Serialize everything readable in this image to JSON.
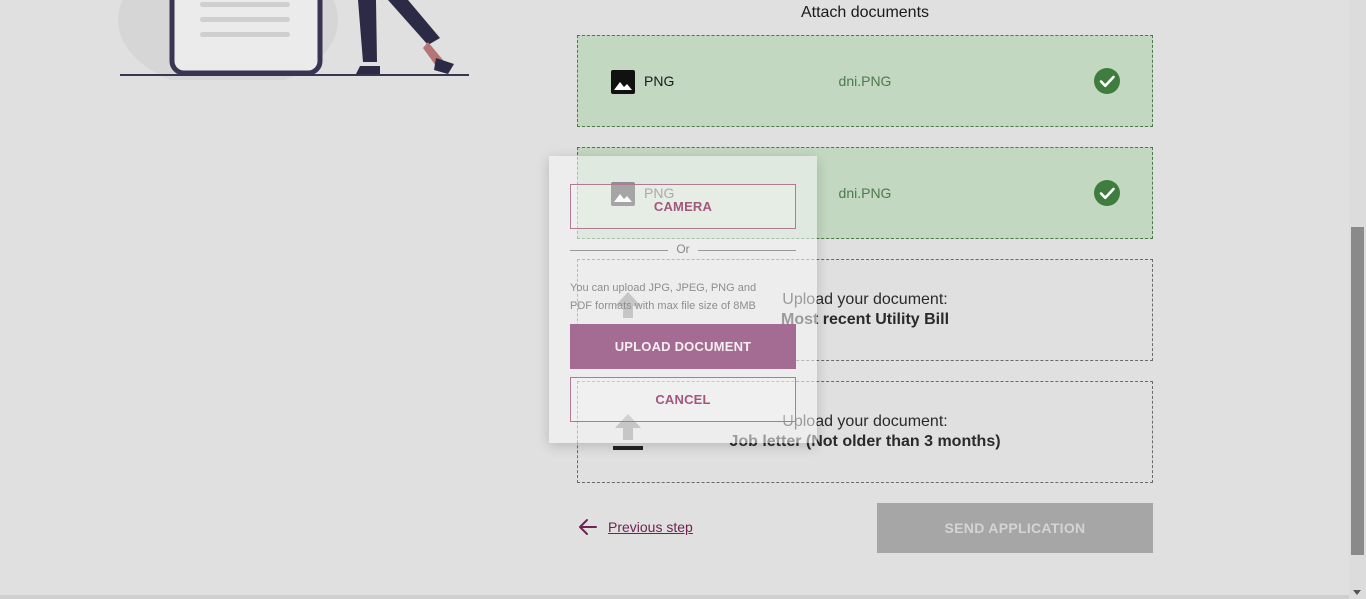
{
  "section": {
    "title": "Attach documents"
  },
  "documents": [
    {
      "type": "PNG",
      "file": "dni.PNG",
      "status": "uploaded"
    },
    {
      "type": "PNG",
      "file": "dni.PNG",
      "status": "uploaded"
    }
  ],
  "uploads": [
    {
      "prompt": "Upload your document:",
      "requirement": "Most recent Utility Bill"
    },
    {
      "prompt": "Upload your document:",
      "requirement": "Job letter (Not older than 3 months)"
    }
  ],
  "nav": {
    "previous_label": "Previous step"
  },
  "actions": {
    "send_label": "SEND APPLICATION"
  },
  "modal": {
    "camera_label": "CAMERA",
    "divider_label": "Or",
    "hint": "You can upload JPG, JPEG, PNG and PDF formats with max file size of 8MB",
    "upload_label": "UPLOAD DOCUMENT",
    "cancel_label": "CANCEL"
  },
  "icons": {
    "file": "image-file-icon",
    "check": "check-circle-icon",
    "upload": "upload-icon",
    "back": "arrow-left-icon"
  },
  "colors": {
    "accent": "#6e2450",
    "success": "#3f7d3f",
    "success_bg": "#c3d8c1",
    "disabled_button": "#a6a6a6",
    "modal_primary": "#a56c93"
  }
}
